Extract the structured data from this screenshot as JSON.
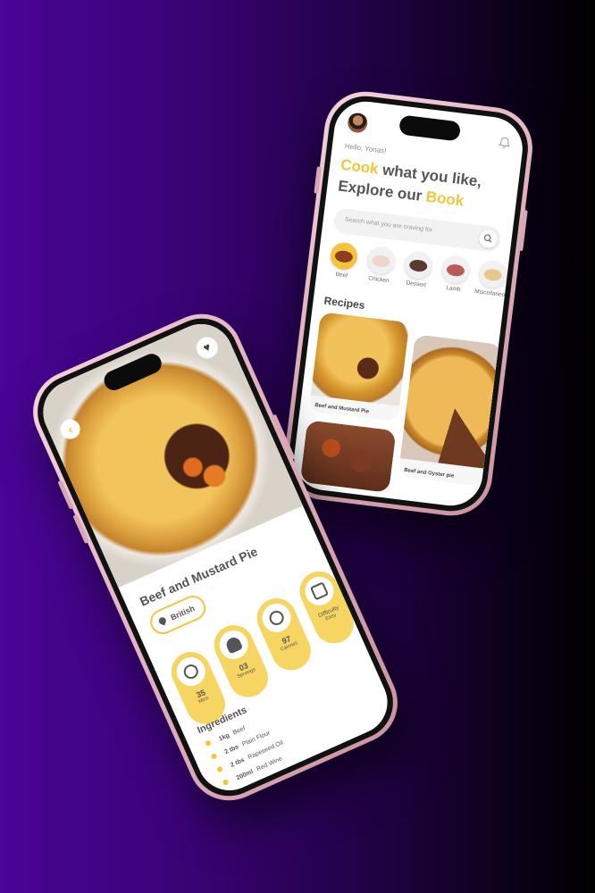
{
  "colors": {
    "accent": "#f4c53a",
    "background_start": "#4a0496",
    "background_end": "#000000"
  },
  "home": {
    "greeting": "Hello, Yonas!",
    "headline": {
      "w1": "Cook",
      "w2": " what you like,",
      "w3": "Explore our ",
      "w4": "Book"
    },
    "search_placeholder": "Search what you are craving for",
    "categories": [
      {
        "label": "Beef",
        "selected": true
      },
      {
        "label": "Chicken"
      },
      {
        "label": "Dessert"
      },
      {
        "label": "Lamb"
      },
      {
        "label": "Miscellaneous"
      }
    ],
    "recipes_title": "Recipes",
    "recipes": [
      {
        "name": "Beef and Mustard Pie"
      },
      {
        "name": "Beef and Oyster pie"
      },
      {
        "name": ""
      }
    ],
    "icons": {
      "avatar": "avatar",
      "notification": "bell-icon",
      "search": "search-icon"
    }
  },
  "detail": {
    "title": "Beef and Mustard Pie",
    "origin": "British",
    "stats": [
      {
        "value": "35",
        "label": "Mins",
        "icon": "clock-icon"
      },
      {
        "value": "03",
        "label": "Servings",
        "icon": "person-icon"
      },
      {
        "value": "97",
        "label": "Calories",
        "icon": "flame-icon"
      },
      {
        "value": "Difficulty",
        "label": "Easy",
        "icon": "layers-icon"
      }
    ],
    "ingredients_title": "Ingredients",
    "ingredients": [
      {
        "qty": "1kg",
        "item": "Beef"
      },
      {
        "qty": "2 tbs",
        "item": "Plain Flour"
      },
      {
        "qty": "2 tbs",
        "item": "Rapeseed Oil"
      },
      {
        "qty": "200ml",
        "item": "Red Wine"
      }
    ]
  }
}
